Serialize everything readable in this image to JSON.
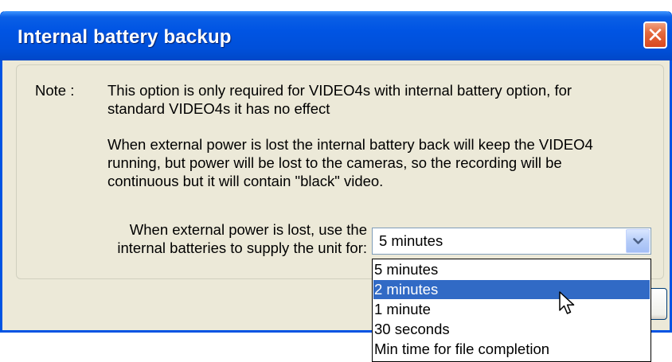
{
  "window": {
    "title": "Internal battery backup"
  },
  "titlebar": {
    "close_icon": "close-icon"
  },
  "note": {
    "label": "Note :",
    "line1": "This option is only required for VIDEO4s with internal battery option, for",
    "line2": "standard VIDEO4s it has no effect",
    "para2_line1": "When external power is lost the internal battery back will keep the VIDEO4",
    "para2_line2": "running, but power will be lost to the cameras, so the recording will be",
    "para2_line3": "continuous but it will contain \"black\" video."
  },
  "duration": {
    "label_line1": "When external power is lost, use the",
    "label_line2": "internal batteries to supply the unit for:",
    "selected": "5 minutes",
    "dropdown_icon": "chevron-down-icon",
    "options": [
      "5 minutes",
      "2 minutes",
      "1 minute",
      "30 seconds",
      "Min time for file completion"
    ],
    "highlighted": "2 minutes"
  },
  "pointer": {
    "icon": "mouse-pointer-icon"
  },
  "colors": {
    "titlebar": "#0054e3",
    "dialog_bg": "#ece9d8",
    "highlight": "#316ac5",
    "close_button": "#e46a3e"
  }
}
